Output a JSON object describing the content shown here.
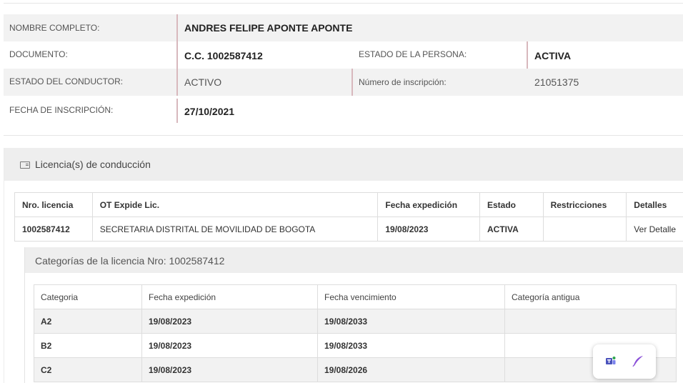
{
  "person": {
    "nombre_label": "NOMBRE COMPLETO:",
    "nombre_value": "ANDRES FELIPE APONTE APONTE",
    "documento_label": "DOCUMENTO:",
    "documento_value": "C.C. 1002587412",
    "estado_persona_label": "ESTADO DE LA PERSONA:",
    "estado_persona_value": "ACTIVA",
    "estado_conductor_label": "ESTADO DEL CONDUCTOR:",
    "estado_conductor_value": "ACTIVO",
    "numero_inscripcion_label": "Número de inscripción:",
    "numero_inscripcion_value": "21051375",
    "fecha_inscripcion_label": "FECHA DE INSCRIPCIÓN:",
    "fecha_inscripcion_value": "27/10/2021"
  },
  "licencias": {
    "title": "Licencia(s) de conducción",
    "icon": "id-card-icon",
    "headers": [
      "Nro. licencia",
      "OT Expide Lic.",
      "Fecha expedición",
      "Estado",
      "Restricciones",
      "Detalles"
    ],
    "rows": [
      {
        "nro": "1002587412",
        "ot": "SECRETARIA DISTRITAL DE MOVILIDAD DE BOGOTA",
        "fecha": "19/08/2023",
        "estado": "ACTIVA",
        "restricciones": "",
        "detalles": "Ver Detalle"
      }
    ]
  },
  "categorias": {
    "title": "Categorías de la licencia Nro: 1002587412",
    "headers": [
      "Categoria",
      "Fecha expedición",
      "Fecha vencimiento",
      "Categoría antigua"
    ],
    "rows": [
      {
        "cat": "A2",
        "exp": "19/08/2023",
        "venc": "19/08/2033",
        "antigua": ""
      },
      {
        "cat": "B2",
        "exp": "19/08/2023",
        "venc": "19/08/2033",
        "antigua": ""
      },
      {
        "cat": "C2",
        "exp": "19/08/2023",
        "venc": "19/08/2026",
        "antigua": ""
      }
    ]
  },
  "floating_toolbar": {
    "icons": [
      "teams-icon",
      "feather-pen-icon"
    ],
    "colors": {
      "teams": "#4b53bc",
      "feather": "#8a4fd8"
    }
  },
  "colors": {
    "accent_bar": "#d8b8bd",
    "row_shade": "#f2f2f2",
    "panel_header": "#eeeeee"
  }
}
